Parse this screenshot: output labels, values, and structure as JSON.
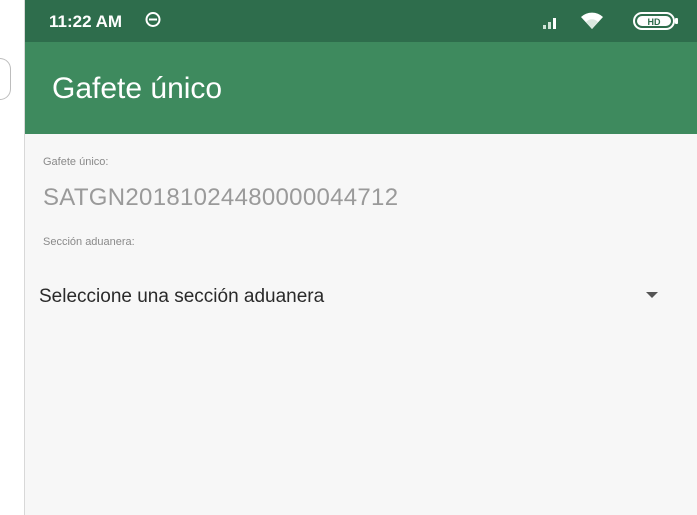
{
  "statusbar": {
    "time": "11:22 AM",
    "icons": [
      "notification-icon",
      "signal-icon",
      "wifi-icon",
      "battery-icon"
    ],
    "battery_text": "HD"
  },
  "appbar": {
    "title": "Gafete único"
  },
  "form": {
    "gafete_label": "Gafete único:",
    "gafete_value": "SATGN20181024480000044712",
    "seccion_label": "Sección aduanera:",
    "seccion_selected": "Seleccione una sección aduanera"
  },
  "colors": {
    "statusbar": "#2e6d4c",
    "appbar": "#3e8a5e",
    "background": "#f7f7f7"
  }
}
